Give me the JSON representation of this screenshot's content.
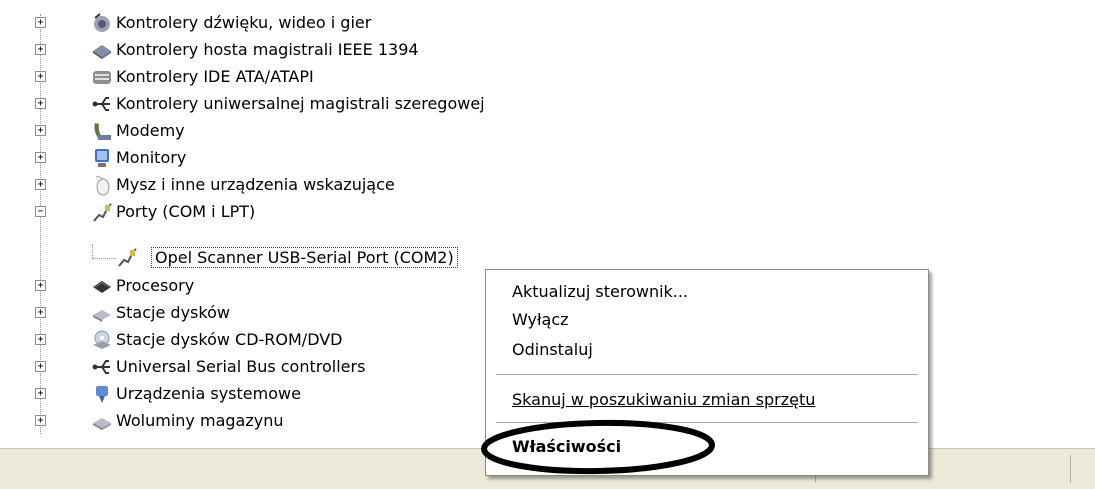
{
  "tree": {
    "items": [
      {
        "label": "Kontrolery dźwięku, wideo i gier",
        "icon": "sound-icon",
        "expander": "+"
      },
      {
        "label": "Kontrolery hosta magistrali IEEE 1394",
        "icon": "ieee1394-icon",
        "expander": "+"
      },
      {
        "label": "Kontrolery IDE ATA/ATAPI",
        "icon": "ide-controller-icon",
        "expander": "+"
      },
      {
        "label": "Kontrolery uniwersalnej magistrali szeregowej",
        "icon": "usb-icon",
        "expander": "+"
      },
      {
        "label": "Modemy",
        "icon": "modem-icon",
        "expander": "+"
      },
      {
        "label": "Monitory",
        "icon": "monitor-icon",
        "expander": "+"
      },
      {
        "label": "Mysz i inne urządzenia wskazujące",
        "icon": "mouse-icon",
        "expander": "+"
      },
      {
        "label": "Porty (COM i LPT)",
        "icon": "port-icon",
        "expander": "−"
      },
      {
        "label": "Opel Scanner USB-Serial Port (COM2)",
        "icon": "port-icon"
      },
      {
        "label": "Procesory",
        "icon": "processor-icon",
        "expander": "+"
      },
      {
        "label": "Stacje dysków",
        "icon": "floppy-drive-icon",
        "expander": "+"
      },
      {
        "label": "Stacje dysków CD-ROM/DVD",
        "icon": "cdrom-icon",
        "expander": "+"
      },
      {
        "label": "Universal Serial Bus controllers",
        "icon": "usb-icon",
        "expander": "+"
      },
      {
        "label": "Urządzenia systemowe",
        "icon": "system-device-icon",
        "expander": "+"
      },
      {
        "label": "Woluminy magazynu",
        "icon": "storage-volume-icon",
        "expander": "+"
      }
    ]
  },
  "context_menu": {
    "update_driver": "Aktualizuj sterownik...",
    "disable": "Wyłącz",
    "uninstall": "Odinstaluj",
    "scan_changes": "Skanuj w poszukiwaniu zmian sprzętu",
    "properties": "Właściwości"
  },
  "colors": {
    "annotation": "#000000",
    "statusbar": "#ece9d8"
  }
}
